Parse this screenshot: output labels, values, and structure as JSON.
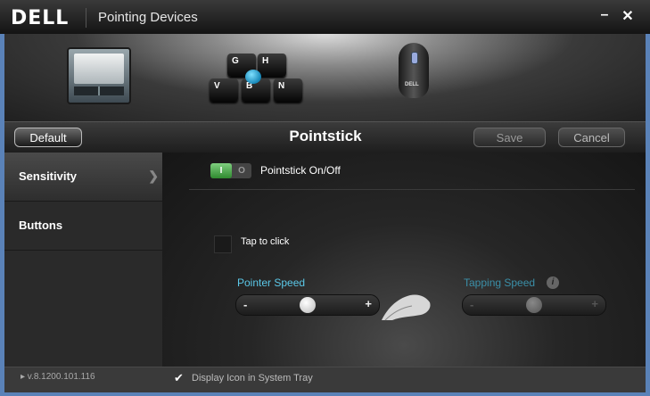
{
  "window": {
    "logo": "DELL",
    "title": "Pointing Devices",
    "minimize_glyph": "–",
    "close_glyph": "✕"
  },
  "devices": {
    "touchpad_icon": "touchpad-icon",
    "pointstick_icon": "pointstick-keys-icon",
    "mouse_icon": "mouse-icon",
    "keys": [
      "G",
      "H",
      "V",
      "B",
      "N"
    ],
    "mouse_brand": "DELL"
  },
  "toolbar": {
    "default_label": "Default",
    "page_title": "Pointstick",
    "save_label": "Save",
    "cancel_label": "Cancel"
  },
  "sidebar": {
    "items": [
      {
        "label": "Sensitivity",
        "active": true
      },
      {
        "label": "Buttons",
        "active": false
      }
    ],
    "chevron_glyph": "❯"
  },
  "main": {
    "toggle": {
      "on_label": "I",
      "off_label": "O",
      "state": "on"
    },
    "toggle_label": "Pointstick On/Off",
    "tap_to_click_label": "Tap to click",
    "tap_to_click_checked": false,
    "pointer_speed": {
      "label": "Pointer Speed",
      "minus": "-",
      "plus": "+",
      "value_fraction": 0.5
    },
    "tapping_speed": {
      "label": "Tapping Speed",
      "minus": "-",
      "plus": "+",
      "value_fraction": 0.5,
      "enabled": false
    },
    "info_glyph": "i"
  },
  "footer": {
    "version": "▸ v.8.1200.101.116",
    "tray_checked": true,
    "tray_checkmark": "✔",
    "tray_label": "Display Icon in System Tray"
  },
  "colors": {
    "frame_border": "#5a82b8",
    "accent_teal": "#5bc8e8",
    "toggle_green": "#3f9f3f"
  }
}
